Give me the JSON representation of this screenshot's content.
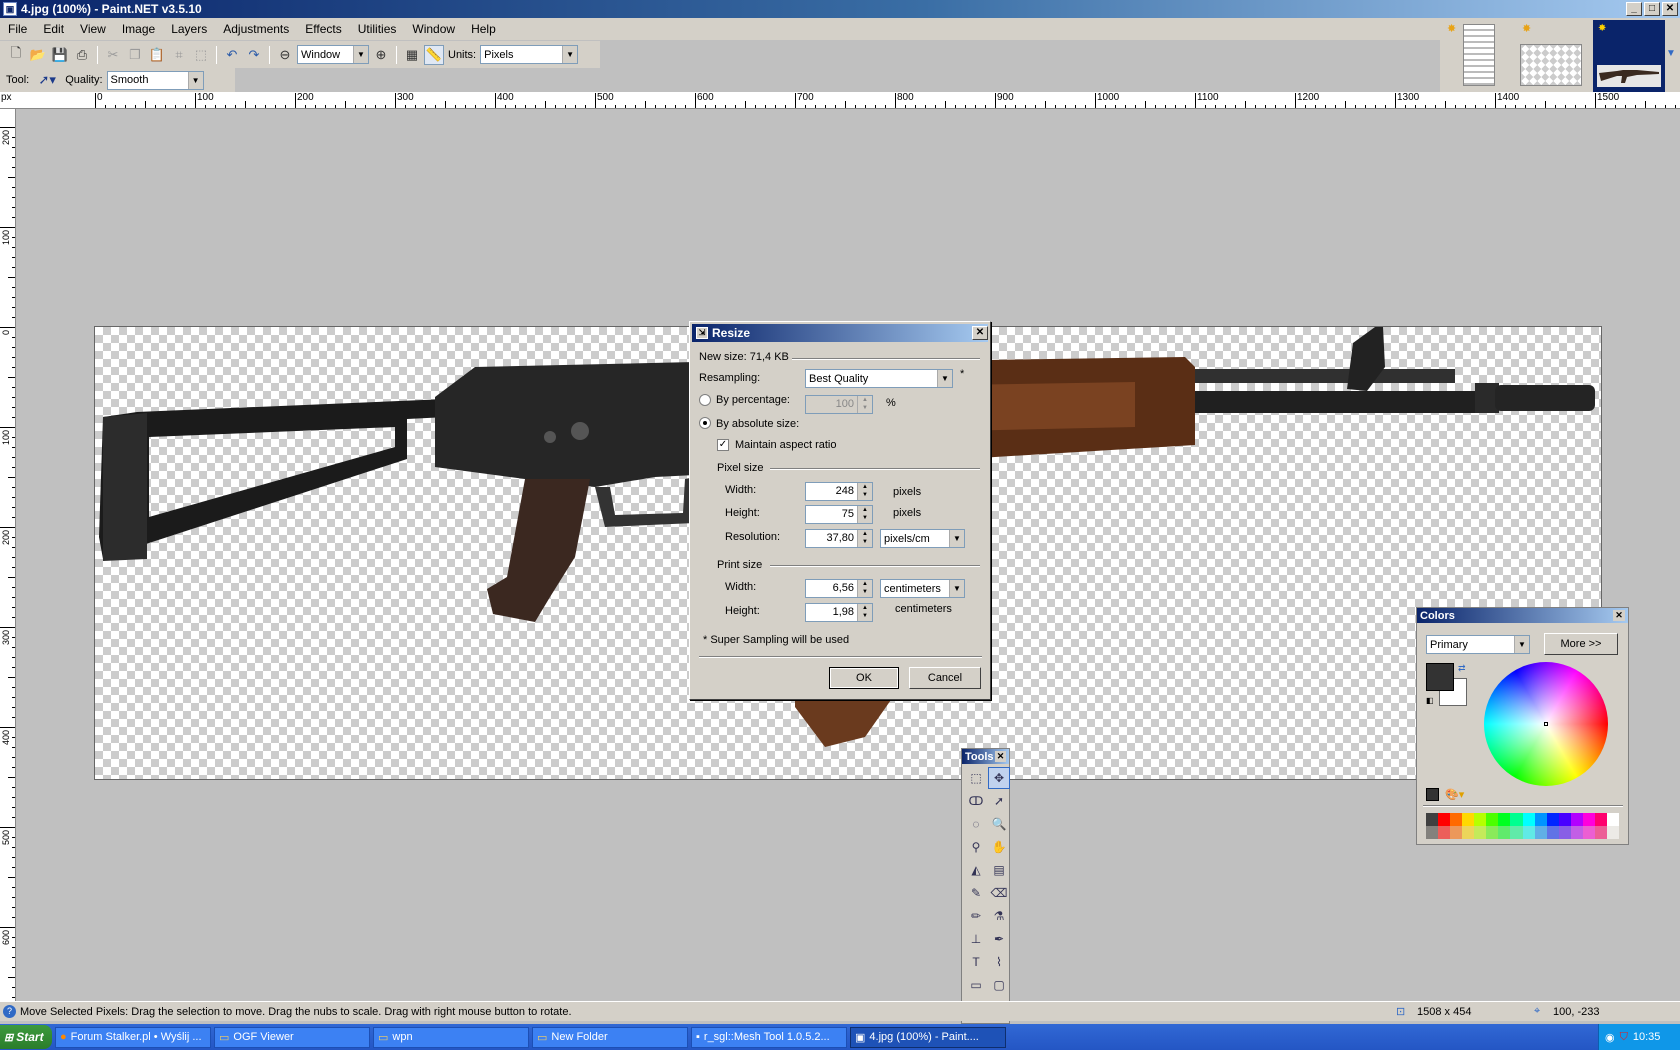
{
  "window": {
    "title": "4.jpg (100%) - Paint.NET v3.5.10",
    "min": "_",
    "max": "□",
    "close": "✕"
  },
  "menu": [
    "File",
    "Edit",
    "View",
    "Image",
    "Layers",
    "Adjustments",
    "Effects",
    "Utilities",
    "Window",
    "Help"
  ],
  "toolbar": {
    "zoom_value": "Window",
    "units_label": "Units:",
    "units_value": "Pixels",
    "tool_label": "Tool:",
    "quality_label": "Quality:",
    "quality_value": "Smooth"
  },
  "ruler": {
    "unit": "px",
    "top_labels": [
      "0",
      "100",
      "200",
      "300",
      "400",
      "500",
      "600",
      "700",
      "800",
      "900",
      "1000",
      "1100",
      "1200",
      "1300",
      "1400",
      "1500"
    ],
    "left_labels": [
      "200",
      "100",
      "0",
      "100",
      "200",
      "300",
      "400",
      "500",
      "600"
    ]
  },
  "resize_dialog": {
    "title": "Resize",
    "new_size": "New size: 71,4 KB",
    "resampling_label": "Resampling:",
    "resampling_value": "Best Quality",
    "star": "*",
    "by_percentage_label": "By percentage:",
    "percentage_value": "100",
    "percent_sign": "%",
    "by_absolute_label": "By absolute size:",
    "maintain_aspect_label": "Maintain aspect ratio",
    "maintain_aspect_checked": true,
    "pixel_size_label": "Pixel size",
    "width_label": "Width:",
    "width_value": "248",
    "width_unit": "pixels",
    "height_label": "Height:",
    "height_value": "75",
    "height_unit": "pixels",
    "resolution_label": "Resolution:",
    "resolution_value": "37,80",
    "resolution_unit": "pixels/cm",
    "print_size_label": "Print size",
    "print_width_label": "Width:",
    "print_width_value": "6,56",
    "print_width_unit": "centimeters",
    "print_height_label": "Height:",
    "print_height_value": "1,98",
    "print_height_unit": "centimeters",
    "note": "* Super Sampling will be used",
    "ok": "OK",
    "cancel": "Cancel"
  },
  "colors_panel": {
    "title": "Colors",
    "mode": "Primary",
    "more": "More >>",
    "palette": [
      "#404040",
      "#ff0000",
      "#ff6a00",
      "#ffd800",
      "#b6ff00",
      "#4cff00",
      "#00ff21",
      "#00ff90",
      "#00ffff",
      "#0094ff",
      "#0026ff",
      "#4800ff",
      "#b200ff",
      "#ff00dc",
      "#ff006e",
      "#ffffff"
    ]
  },
  "tools_panel": {
    "title": "Tools",
    "tools": [
      "rectangle-select-icon",
      "move-selection-icon",
      "lasso-select-icon",
      "move-selection-only-icon",
      "ellipse-select-icon",
      "zoom-icon",
      "magic-wand-icon",
      "pan-icon",
      "paint-bucket-icon",
      "gradient-icon",
      "paintbrush-icon",
      "eraser-icon",
      "pencil-icon",
      "color-picker-icon",
      "clone-stamp-icon",
      "recolor-icon",
      "text-icon",
      "line-curve-icon",
      "rectangle-icon",
      "rounded-rectangle-icon",
      "ellipse-icon",
      "freeform-shape-icon"
    ]
  },
  "status": {
    "message": "Move Selected Pixels: Drag the selection to move. Drag the nubs to scale. Drag with right mouse button to rotate.",
    "image_size": "1508 x 454",
    "cursor": "100, -233"
  },
  "taskbar": {
    "start": "Start",
    "tasks": [
      "Forum Stalker.pl • Wyślij ...",
      "OGF Viewer",
      "wpn",
      "New Folder",
      "r_sgl::Mesh Tool 1.0.5.2...",
      "4.jpg (100%) - Paint...."
    ],
    "clock": "10:35"
  }
}
